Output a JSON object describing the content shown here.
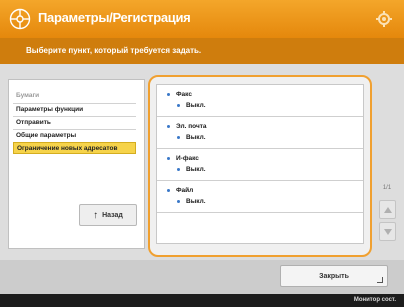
{
  "header": {
    "title": "Параметры/Регистрация",
    "app_icon": "settings-wheel-icon",
    "settings_icon": "gear-icon"
  },
  "instruction": "Выберите пункт, который требуется задать.",
  "left_menu": {
    "items": [
      {
        "label": "Бумаги",
        "state": "dim"
      },
      {
        "label": "Параметры функции",
        "state": "normal"
      },
      {
        "label": "Отправить",
        "state": "normal"
      },
      {
        "label": "Общие параметры",
        "state": "normal"
      },
      {
        "label": "Ограничение новых адресатов",
        "state": "selected"
      }
    ],
    "back_label": "Назад"
  },
  "right_list": {
    "groups": [
      {
        "label": "Факс",
        "value": "Выкл."
      },
      {
        "label": "Эл. почта",
        "value": "Выкл."
      },
      {
        "label": "И-факс",
        "value": "Выкл."
      },
      {
        "label": "Файл",
        "value": "Выкл."
      }
    ]
  },
  "scroll": {
    "page_count": "1/1"
  },
  "footer": {
    "close_label": "Закрыть"
  },
  "status_bar": {
    "text": "Монитор сост."
  },
  "colors": {
    "accent": "#e8900f",
    "instruction_bg": "#cf7d0d",
    "selected": "#f6d34a",
    "highlight_border": "#f0a030"
  }
}
